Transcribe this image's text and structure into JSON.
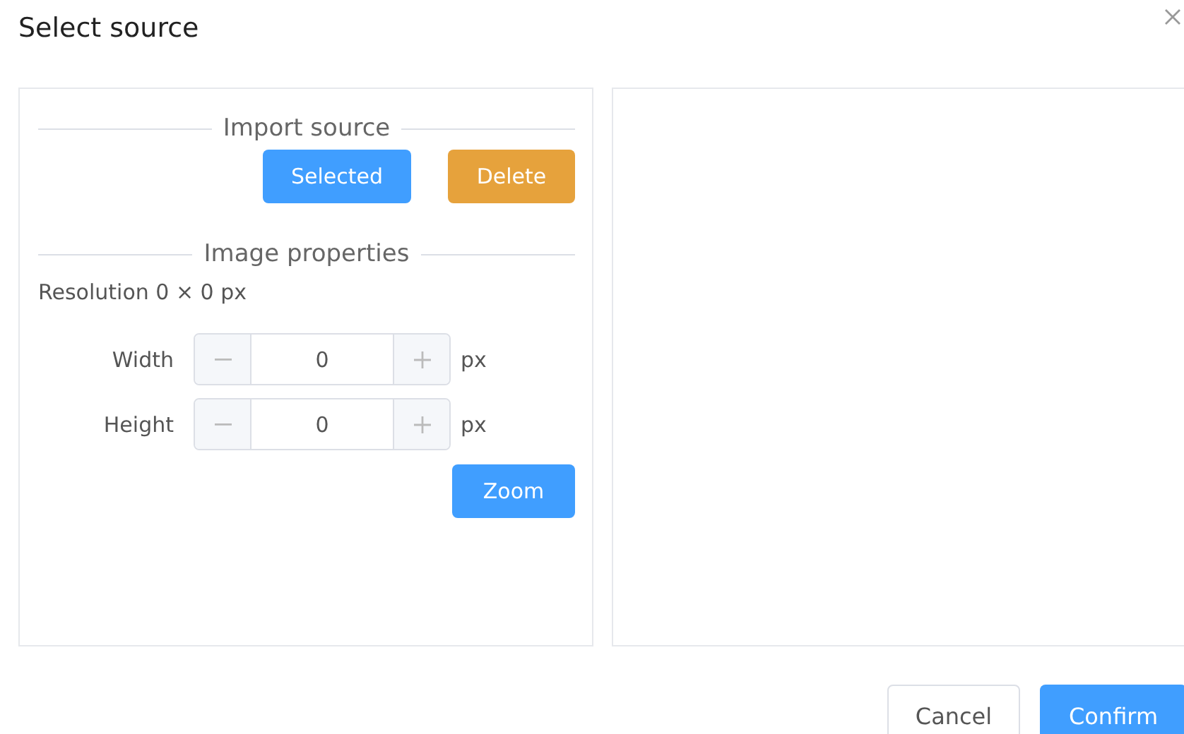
{
  "dialog": {
    "title": "Select source"
  },
  "import_section": {
    "heading": "Import source",
    "buttons": [
      {
        "label": "Selected",
        "kind": "primary"
      },
      {
        "label": "Delete",
        "kind": "warning"
      }
    ]
  },
  "properties_section": {
    "heading": "Image properties",
    "resolution": "Resolution 0 × 0 px",
    "fields": [
      {
        "label": "Width",
        "value": "0",
        "unit": "px"
      },
      {
        "label": "Height",
        "value": "0",
        "unit": "px"
      }
    ],
    "button": {
      "label": "Zoom",
      "kind": "primary"
    }
  },
  "footer": {
    "buttons": [
      {
        "label": "Cancel",
        "kind": "default"
      },
      {
        "label": "Confirm",
        "kind": "primary"
      }
    ]
  }
}
